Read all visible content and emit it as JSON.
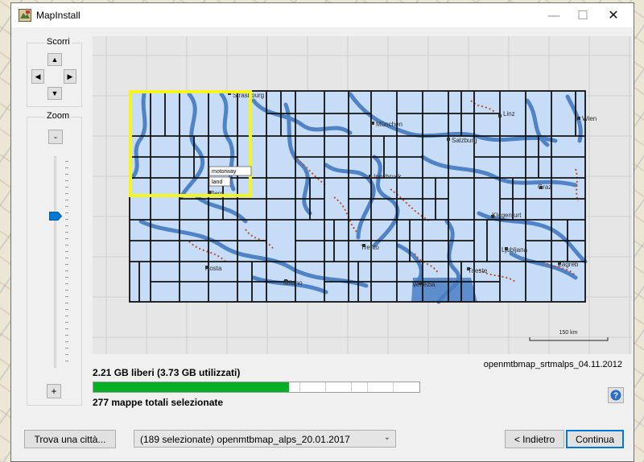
{
  "window": {
    "title": "MapInstall"
  },
  "scroll_group": {
    "label": "Scorri"
  },
  "zoom_group": {
    "label": "Zoom",
    "minus_label": "-",
    "plus_label": "+",
    "level_fraction": 0.28
  },
  "map": {
    "labels": {
      "strasbourg": "Strasbourg",
      "munchen": "München",
      "salzburg": "Salzburg",
      "linz": "Linz",
      "wien": "Wien",
      "innsbruck": "Innsbruck",
      "graz": "Graz",
      "klagenfurt": "Klagenfurt",
      "trento": "Trento",
      "zagreb": "Zagreb",
      "ljubljana": "Ljubljana",
      "trieste": "Trieste",
      "venezia": "Venezia",
      "milano": "Milano",
      "aosta": "Aosta",
      "bern": "Bern"
    },
    "tooltip": {
      "line1": "motorway",
      "line2": "land"
    },
    "scale_label": "150 km",
    "highlight_color": "#f5f51e",
    "tile_fill": "#c6dcf7",
    "river_color": "#4a7fc4"
  },
  "status": {
    "free_space": "2.21 GB liberi (3.73 GB utilizzati)",
    "usage_fraction": 0.6,
    "selected_count": "277 mappe totali selezionate",
    "map_version": "openmtbmap_srtmalps_04.11.2012"
  },
  "footer": {
    "find_city": "Trova una città...",
    "map_select_value": "(189 selezionate) openmtbmap_alps_20.01.2017",
    "back": "< Indietro",
    "continue": "Continua"
  },
  "colors": {
    "progress": "#06b025",
    "accent": "#0078d7"
  }
}
